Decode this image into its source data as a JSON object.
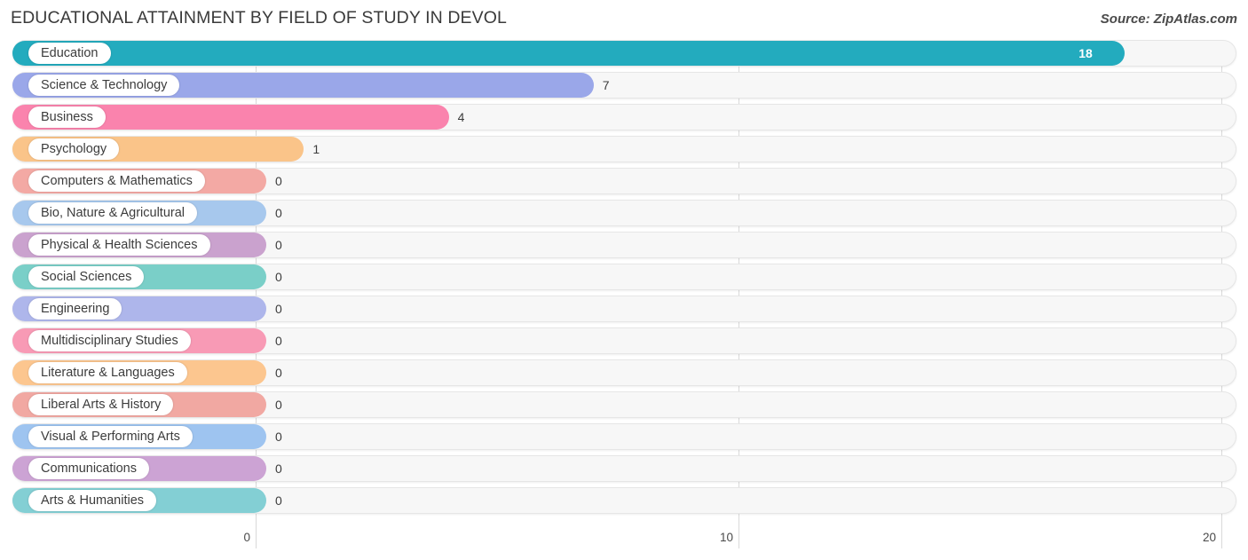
{
  "header": {
    "title": "EDUCATIONAL ATTAINMENT BY FIELD OF STUDY IN DEVOL",
    "source": "Source: ZipAtlas.com"
  },
  "chart_data": {
    "type": "bar",
    "orientation": "horizontal",
    "title": "EDUCATIONAL ATTAINMENT BY FIELD OF STUDY IN DEVOL",
    "xlabel": "",
    "ylabel": "",
    "xlim": [
      0,
      20
    ],
    "xticks": [
      0,
      10,
      20
    ],
    "xtick_labels": [
      "0",
      "10",
      "20"
    ],
    "grid": true,
    "legend": false,
    "categories": [
      "Education",
      "Science & Technology",
      "Business",
      "Psychology",
      "Computers & Mathematics",
      "Bio, Nature & Agricultural",
      "Physical & Health Sciences",
      "Social Sciences",
      "Engineering",
      "Multidisciplinary Studies",
      "Literature & Languages",
      "Liberal Arts & History",
      "Visual & Performing Arts",
      "Communications",
      "Arts & Humanities"
    ],
    "values": [
      18,
      7,
      4,
      1,
      0,
      0,
      0,
      0,
      0,
      0,
      0,
      0,
      0,
      0,
      0
    ],
    "value_labels": [
      "18",
      "7",
      "4",
      "1",
      "0",
      "0",
      "0",
      "0",
      "0",
      "0",
      "0",
      "0",
      "0",
      "0",
      "0"
    ],
    "colors": [
      "#25aabd",
      "#9aa7e8",
      "#f884ad",
      "#f9c48a",
      "#f2a9a4",
      "#a8c8ec",
      "#c9a2cd",
      "#7bcfc8",
      "#aeb6ea",
      "#f79ab5",
      "#fbc690",
      "#f0a8a2",
      "#9fc4ef",
      "#cba3d3",
      "#84cfd4"
    ]
  },
  "axis": {
    "ticks": [
      "0",
      "10",
      "20"
    ]
  }
}
